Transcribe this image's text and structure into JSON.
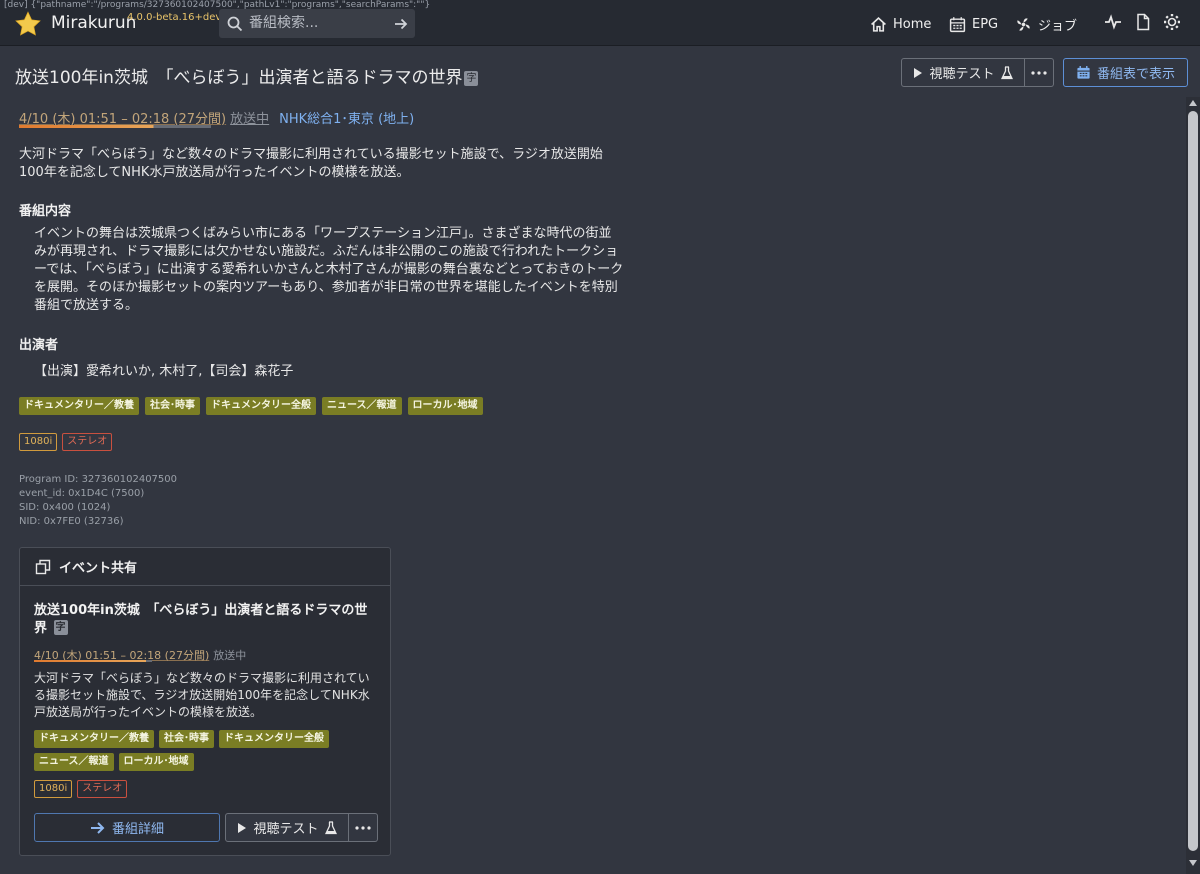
{
  "dev_banner": "[dev] {\"pathname\":\"/programs/327360102407500\",\"pathLv1\":\"programs\",\"searchParams\":\"\"}",
  "app": {
    "name": "Mirakurun",
    "version": "4.0.0-beta.16+dev"
  },
  "search": {
    "placeholder": "番組検索..."
  },
  "nav": {
    "home": "Home",
    "epg": "EPG",
    "jobs": "ジョブ"
  },
  "program": {
    "title": "放送100年in茨城　「べらぼう」出演者と語るドラマの世界",
    "subtitle_mark": "字",
    "time_range": "4/10 (木) 01:51 – 02:18 (27分間)",
    "status": "放送中",
    "channel": "NHK総合1･東京 (地上)",
    "description": "大河ドラマ「べらぼう」など数々のドラマ撮影に利用されている撮影セット施設で、ラジオ放送開始100年を記念してNHK水戸放送局が行ったイベントの模様を放送。",
    "detail_heading": "番組内容",
    "detail_text": "イベントの舞台は茨城県つくばみらい市にある「ワープステーション江戸」。さまざまな時代の街並みが再現され、ドラマ撮影には欠かせない施設だ。ふだんは非公開のこの施設で行われたトークショーでは、「べらぼう」に出演する愛希れいかさんと木村了さんが撮影の舞台裏などとっておきのトークを展開。そのほか撮影セットの案内ツアーもあり、参加者が非日常の世界を堪能したイベントを特別番組で放送する。",
    "cast_heading": "出演者",
    "cast_text": "【出演】愛希れいか, 木村了,【司会】森花子",
    "genres": [
      "ドキュメンタリー／教養",
      "社会･時事",
      "ドキュメンタリー全般",
      "ニュース／報道",
      "ローカル･地域"
    ],
    "video": "1080i",
    "audio": "ステレオ",
    "program_id": "Program ID: 327360102407500",
    "event_id": "event_id: 0x1D4C (7500)",
    "sid": "SID: 0x400 (1024)",
    "nid": "NID: 0x7FE0 (32736)"
  },
  "buttons": {
    "watch_test": "視聴テスト",
    "show_epg": "番組表で表示",
    "detail": "番組詳細"
  },
  "share_card": {
    "heading": "イベント共有",
    "title": "放送100年in茨城　「べらぼう」出演者と語るドラマの世界",
    "time_range": "4/10 (木) 01:51 – 02:18 (27分間)",
    "status": "放送中",
    "description": "大河ドラマ「べらぼう」など数々のドラマ撮影に利用されている撮影セット施設で、ラジオ放送開始100年を記念してNHK水戸放送局が行ったイベントの模様を放送。"
  },
  "colors": {
    "accent": "#7fb1f0",
    "tag_bg": "#7a7d24",
    "brand_star": "#f2c94c"
  }
}
